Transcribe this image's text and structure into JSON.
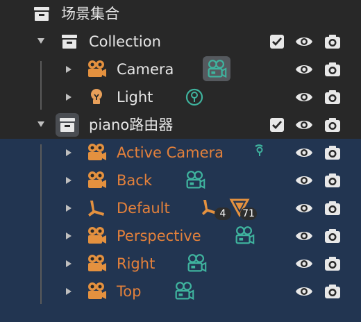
{
  "scene": {
    "label": "场景集合"
  },
  "collections": [
    {
      "label": "Collection"
    },
    {
      "label": "piano路由器"
    }
  ],
  "objects": [
    {
      "label": "Camera"
    },
    {
      "label": "Light"
    },
    {
      "label": "Active Camera"
    },
    {
      "label": "Back"
    },
    {
      "label": "Default"
    },
    {
      "label": "Perspective"
    },
    {
      "label": "Right"
    },
    {
      "label": "Top"
    }
  ],
  "default_badges": {
    "vertex_groups": "4",
    "shape_keys": "71"
  },
  "colors": {
    "background": "#282828",
    "selected_row": "#223551",
    "object_orange": "#e4813b",
    "data_teal": "#3fb39e",
    "light_icon": "#e8a05a"
  },
  "icon_names": [
    "collection-icon",
    "camera-object-icon",
    "light-object-icon",
    "armature-icon",
    "camera-data-icon",
    "light-data-icon",
    "eye-icon",
    "render-camera-icon",
    "checkbox-checked-icon"
  ]
}
